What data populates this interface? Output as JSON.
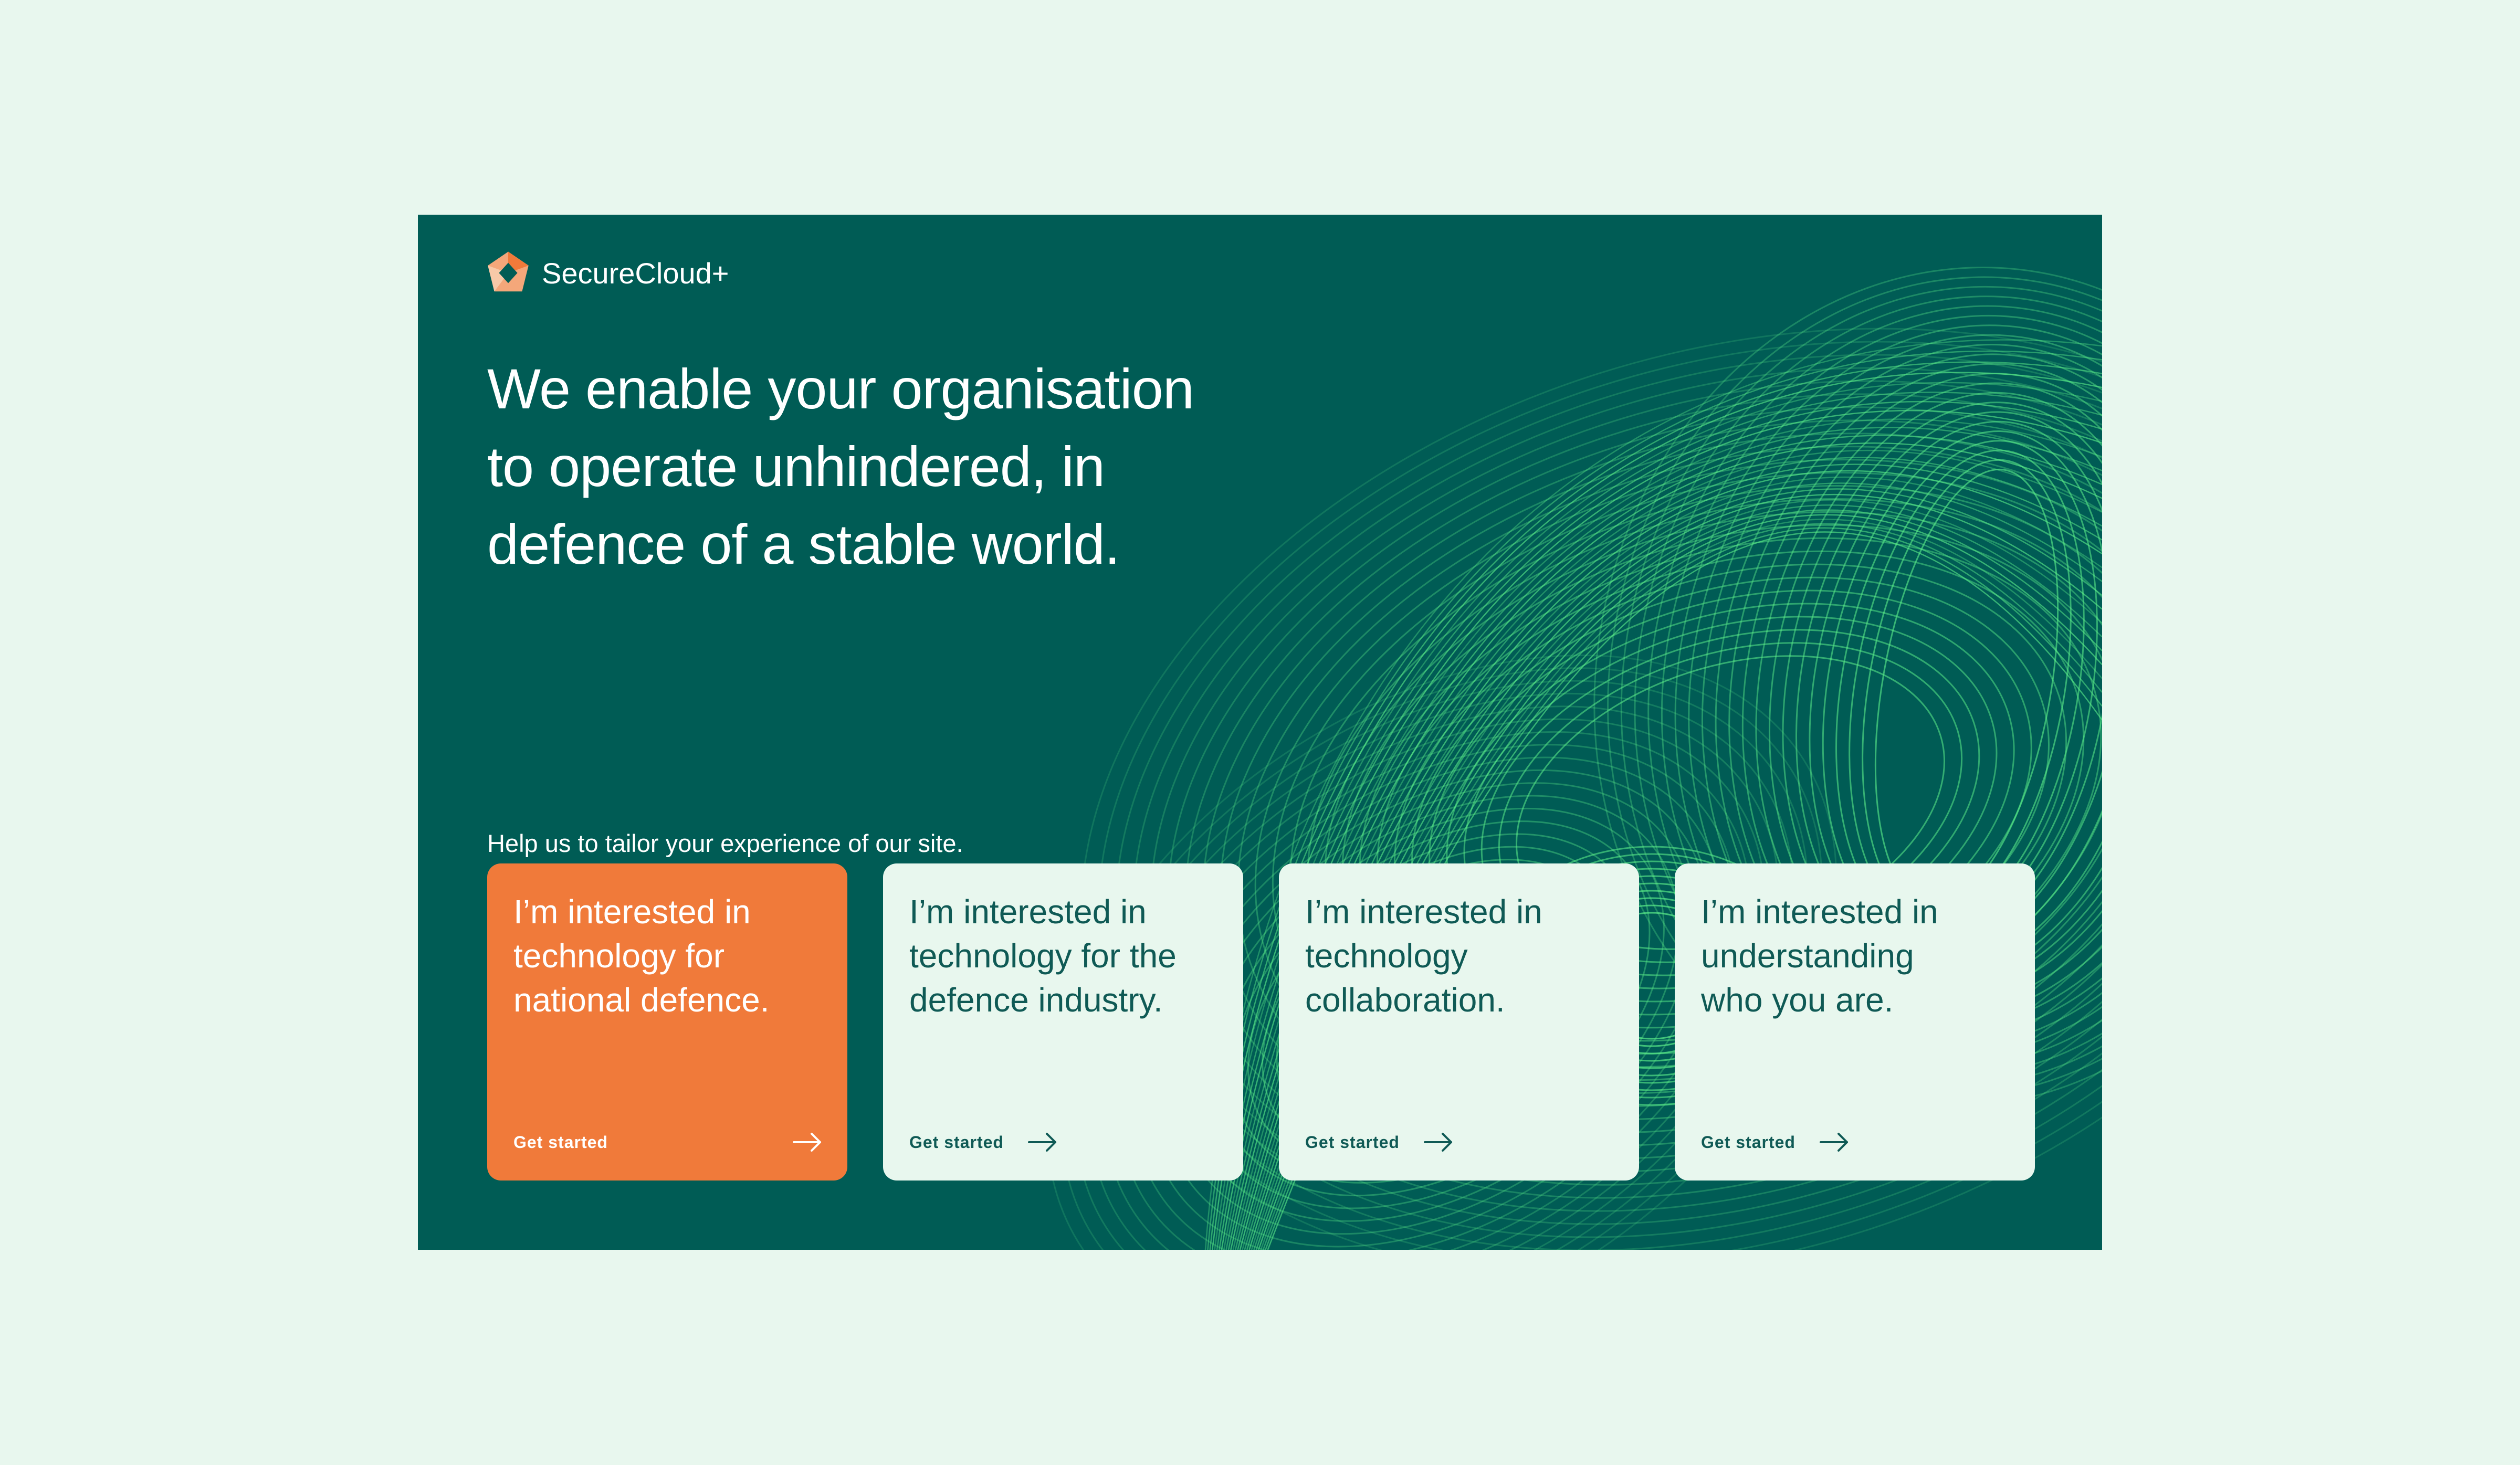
{
  "brand": {
    "name": "SecureCloud+",
    "logo_icon": "securecloud-logo-icon"
  },
  "hero": {
    "headline_line1": "We enable your organisation",
    "headline_line2": "to operate unhindered, in",
    "headline_line3": "defence of a stable world.",
    "subline": "Help us to tailor your experience of our site."
  },
  "cards": [
    {
      "title_line1": "I’m interested in",
      "title_line2": "technology for",
      "title_line3": "national defence.",
      "cta": "Get started",
      "cta_icon": "arrow-right-icon"
    },
    {
      "title_line1": "I’m interested in",
      "title_line2": "technology for the",
      "title_line3": "defence industry.",
      "cta": "Get started",
      "cta_icon": "arrow-right-icon"
    },
    {
      "title_line1": "I’m interested in",
      "title_line2": "technology",
      "title_line3": "collaboration.",
      "cta": "Get started",
      "cta_icon": "arrow-right-icon"
    },
    {
      "title_line1": "I’m interested in",
      "title_line2": "understanding",
      "title_line3": "who you are.",
      "cta": "Get started",
      "cta_icon": "arrow-right-icon"
    }
  ],
  "colors": {
    "page_background": "#e8f7ee",
    "panel_background": "#005c55",
    "accent_orange": "#f07a3a",
    "swirl_green": "#5cf08a",
    "card_text": "#0f5a55"
  }
}
